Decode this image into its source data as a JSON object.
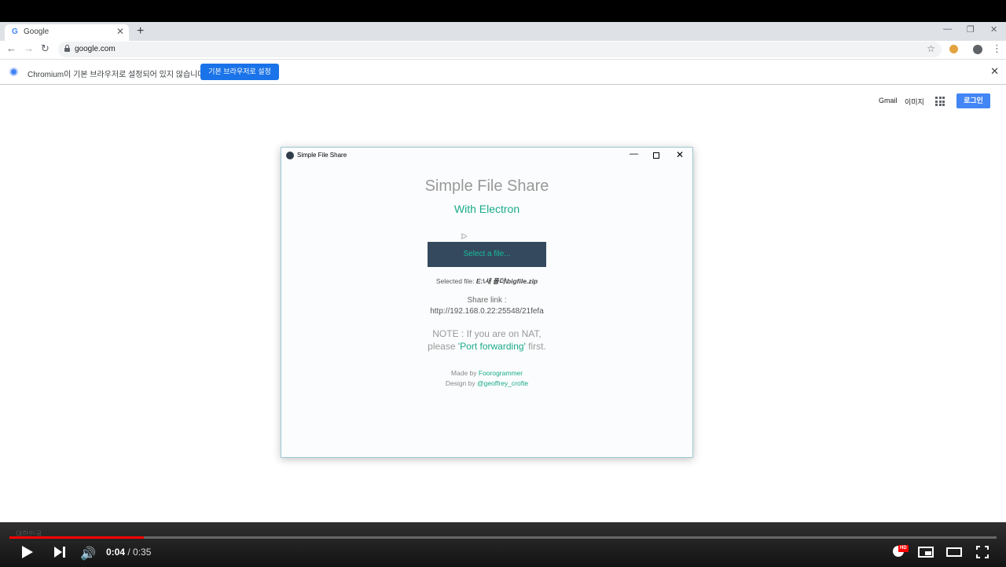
{
  "browser": {
    "tab_title": "Google",
    "tab_favicon": "G",
    "url": "google.com",
    "infobar_message": "Chromium이 기본 브라우저로 설정되어 있지 않습니다",
    "infobar_button": "기본 브라우저로 설정"
  },
  "google": {
    "gmail": "Gmail",
    "images": "이미지",
    "login": "로그인"
  },
  "app": {
    "window_title": "Simple File Share",
    "heading": "Simple File Share",
    "subheading": "With Electron",
    "select_button": "Select a file...",
    "selected_label": "Selected file:",
    "selected_file": "E:\\새 폴더\\bigfile.zip",
    "share_label": "Share link :",
    "share_url": "http://192.168.0.22:25548/21fefa",
    "note_line1": "NOTE : If you are on NAT,",
    "note_line2_pre": "please ",
    "note_line2_link": "'Port forwarding'",
    "note_line2_post": " first.",
    "made_by_label": "Made by ",
    "made_by_name": "Foorogrammer",
    "design_by_label": "Design by ",
    "design_by_name": "@geoffrey_crofte"
  },
  "player": {
    "region_label": "대한민국",
    "current_time": "0:04",
    "separator": " / ",
    "duration": "0:35",
    "progress": 0.136,
    "hd_badge": "HD"
  },
  "colors": {
    "accent": "#1aab8b",
    "progress": "#ff0000",
    "select_button_bg": "#34495e",
    "google_blue": "#4285f4"
  }
}
